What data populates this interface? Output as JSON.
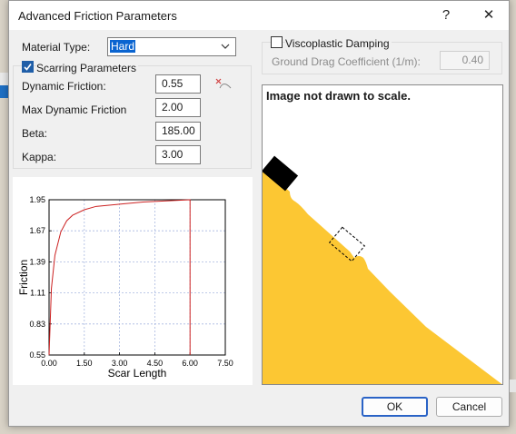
{
  "dialog": {
    "title": "Advanced Friction Parameters",
    "help_symbol": "?",
    "close_symbol": "✕"
  },
  "material": {
    "label": "Material Type:",
    "value": "Hard"
  },
  "scarring": {
    "checkbox_label": "Scarring Parameters",
    "checked": true,
    "rows": [
      {
        "label": "Dynamic Friction:",
        "value": "0.55"
      },
      {
        "label": "Max Dynamic Friction",
        "value": "2.00"
      },
      {
        "label": "Beta:",
        "value": "185.00"
      },
      {
        "label": "Kappa:",
        "value": "3.00"
      }
    ]
  },
  "viscoplastic": {
    "checkbox_label": "Viscoplastic Damping",
    "checked": false,
    "coef_label": "Ground Drag Coefficient (1/m):",
    "coef_value": "0.40"
  },
  "illustration": {
    "note": "Image not drawn to scale.",
    "colors": {
      "ground": "#fcc733",
      "block": "#000000"
    }
  },
  "chart_data": {
    "type": "line",
    "xlabel": "Scar Length",
    "ylabel": "Friction",
    "xlim": [
      0,
      7.5
    ],
    "ylim": [
      0.55,
      1.95
    ],
    "xticks": [
      "0.00",
      "1.50",
      "3.00",
      "4.50",
      "6.00",
      "7.50"
    ],
    "yticks": [
      "0.55",
      "0.83",
      "1.11",
      "1.39",
      "1.67",
      "1.95"
    ],
    "grid": true,
    "series": [
      {
        "color": "#cc2222",
        "x": [
          0,
          0.1,
          0.25,
          0.5,
          0.75,
          1.0,
          1.5,
          2.0,
          3.0,
          4.0,
          5.0,
          6.0,
          6.0
        ],
        "y": [
          0.55,
          1.15,
          1.45,
          1.66,
          1.76,
          1.81,
          1.86,
          1.89,
          1.91,
          1.93,
          1.94,
          1.95,
          0.55
        ]
      }
    ]
  },
  "buttons": {
    "ok": "OK",
    "cancel": "Cancel"
  }
}
